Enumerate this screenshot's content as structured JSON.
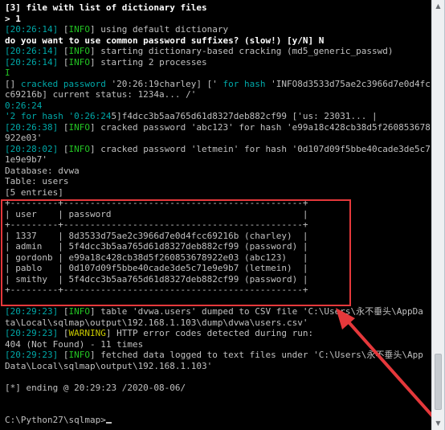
{
  "console": {
    "lines": [
      [
        {
          "t": "[3] file with list of dictionary files",
          "c": "white"
        }
      ],
      [
        {
          "t": "> 1",
          "c": "white"
        }
      ],
      [
        {
          "t": "[20:26:14]",
          "c": "cyan"
        },
        {
          "t": " [",
          "c": "gray"
        },
        {
          "t": "INFO",
          "c": "green"
        },
        {
          "t": "] using default dictionary",
          "c": "gray"
        }
      ],
      [
        {
          "t": "do you want to use common password suffixes? (slow!) [y/N] N",
          "c": "white"
        }
      ],
      [
        {
          "t": "[20:26:14]",
          "c": "cyan"
        },
        {
          "t": " [",
          "c": "gray"
        },
        {
          "t": "INFO",
          "c": "green"
        },
        {
          "t": "] starting dictionary-based cracking (md5_generic_passwd)",
          "c": "gray"
        }
      ],
      [
        {
          "t": "[20:26:14]",
          "c": "cyan"
        },
        {
          "t": " [",
          "c": "gray"
        },
        {
          "t": "INFO",
          "c": "green"
        },
        {
          "t": "] starting 2 processes",
          "c": "gray"
        }
      ],
      [
        {
          "t": "I",
          "c": "green"
        }
      ],
      [
        {
          "t": "[] ",
          "c": "gray"
        },
        {
          "t": "cracked password ",
          "c": "cyan"
        },
        {
          "t": "'20:26:19charley] [' ",
          "c": "gray"
        },
        {
          "t": "for hash ",
          "c": "cyan"
        },
        {
          "t": "'INFO8d3533d75ae2c3966d7e0d4fc",
          "c": "gray"
        }
      ],
      [
        {
          "t": "c69216b] current status: 1234a... /'",
          "c": "gray"
        }
      ],
      [
        {
          "t": "0:26:24",
          "c": "cyan"
        }
      ],
      [
        {
          "t": "'2 for hash '0:26:24",
          "c": "cyan"
        },
        {
          "t": "5]f4dcc3b5aa765d61d8327deb882cf99 ['us: 23031... |",
          "c": "gray"
        }
      ],
      [
        {
          "t": "[20:26:38]",
          "c": "cyan"
        },
        {
          "t": " [",
          "c": "gray"
        },
        {
          "t": "INFO",
          "c": "green"
        },
        {
          "t": "] cracked password 'abc123' for hash 'e99a18c428cb38d5f260853678",
          "c": "gray"
        }
      ],
      [
        {
          "t": "922e03'",
          "c": "gray"
        }
      ],
      [
        {
          "t": "[20:28:02]",
          "c": "cyan"
        },
        {
          "t": " [",
          "c": "gray"
        },
        {
          "t": "INFO",
          "c": "green"
        },
        {
          "t": "] cracked password 'letmein' for hash '0d107d09f5bbe40cade3de5c7",
          "c": "gray"
        }
      ],
      [
        {
          "t": "1e9e9b7'",
          "c": "gray"
        }
      ],
      [
        {
          "t": "Database: dvwa",
          "c": "gray"
        }
      ],
      [
        {
          "t": "Table: users",
          "c": "gray"
        }
      ],
      [
        {
          "t": "[5 entries]",
          "c": "gray"
        }
      ],
      [
        {
          "t": "+---------+---------------------------------------------+",
          "c": "gray"
        }
      ],
      [
        {
          "t": "| user    | password                                    |",
          "c": "gray"
        }
      ],
      [
        {
          "t": "+---------+---------------------------------------------+",
          "c": "gray"
        }
      ],
      [
        {
          "t": "| 1337    | 8d3533d75ae2c3966d7e0d4fcc69216b (charley)  |",
          "c": "gray"
        }
      ],
      [
        {
          "t": "| admin   | 5f4dcc3b5aa765d61d8327deb882cf99 (password) |",
          "c": "gray"
        }
      ],
      [
        {
          "t": "| gordonb | e99a18c428cb38d5f260853678922e03 (abc123)   |",
          "c": "gray"
        }
      ],
      [
        {
          "t": "| pablo   | 0d107d09f5bbe40cade3de5c71e9e9b7 (letmein)  |",
          "c": "gray"
        }
      ],
      [
        {
          "t": "| smithy  | 5f4dcc3b5aa765d61d8327deb882cf99 (password) |",
          "c": "gray"
        }
      ],
      [
        {
          "t": "+---------+---------------------------------------------+",
          "c": "gray"
        }
      ],
      [
        {
          "t": "",
          "c": "gray"
        }
      ],
      [
        {
          "t": "[20:29:23]",
          "c": "cyan"
        },
        {
          "t": " [",
          "c": "gray"
        },
        {
          "t": "INFO",
          "c": "green"
        },
        {
          "t": "] table 'dvwa.users' dumped to CSV file 'C:\\Users\\永不垂头\\AppDa",
          "c": "gray"
        }
      ],
      [
        {
          "t": "ta\\Local\\sqlmap\\output\\192.168.1.103\\dump\\dvwa\\users.csv'",
          "c": "gray"
        }
      ],
      [
        {
          "t": "[20:29:23]",
          "c": "cyan"
        },
        {
          "t": " [",
          "c": "gray"
        },
        {
          "t": "WARNING",
          "c": "yellow"
        },
        {
          "t": "] HTTP error codes detected during run:",
          "c": "gray"
        }
      ],
      [
        {
          "t": "404 (Not Found) - 11 times",
          "c": "gray"
        }
      ],
      [
        {
          "t": "[20:29:23]",
          "c": "cyan"
        },
        {
          "t": " [",
          "c": "gray"
        },
        {
          "t": "INFO",
          "c": "green"
        },
        {
          "t": "] fetched data logged to text files under 'C:\\Users\\永不垂头\\App",
          "c": "gray"
        }
      ],
      [
        {
          "t": "Data\\Local\\sqlmap\\output\\192.168.1.103'",
          "c": "gray"
        }
      ],
      [
        {
          "t": "",
          "c": "gray"
        }
      ],
      [
        {
          "t": "[*] ending @ 20:29:23 /2020-08-06/",
          "c": "gray"
        }
      ],
      [
        {
          "t": "",
          "c": "gray"
        }
      ],
      [
        {
          "t": "",
          "c": "gray"
        }
      ],
      [
        {
          "t": "C:\\Python27\\sqlmap>",
          "c": "gray"
        }
      ]
    ]
  },
  "colors": {
    "background": "#000000",
    "text": "#c0c0c0",
    "timestamp": "#00a8a8",
    "info": "#23c423",
    "warning": "#c8c800",
    "highlight": "#e5383b"
  },
  "icons": {
    "scroll_up": "chevron-up-icon",
    "scroll_down": "chevron-down-icon",
    "annotation": "red-arrow-annotation"
  }
}
